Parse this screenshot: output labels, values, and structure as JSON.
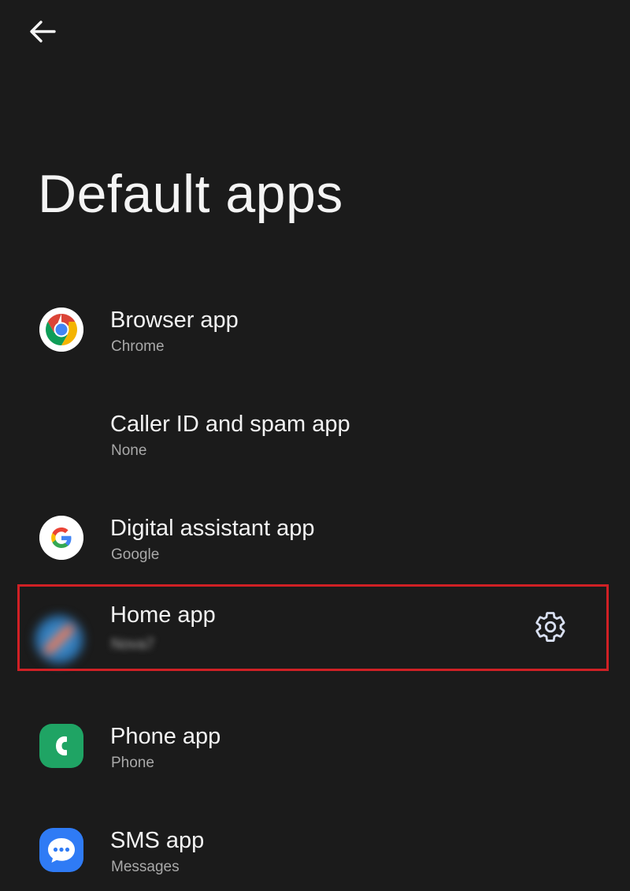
{
  "header": {
    "back_icon": "arrow-back-icon",
    "title": "Default apps"
  },
  "apps": [
    {
      "title": "Browser app",
      "value": "Chrome",
      "icon": "chrome-icon"
    },
    {
      "title": "Caller ID and spam app",
      "value": "None",
      "icon": ""
    },
    {
      "title": "Digital assistant app",
      "value": "Google",
      "icon": "google-icon"
    },
    {
      "title": "Home app",
      "value": "Nova7",
      "icon": "launcher-icon-blurred",
      "action_icon": "gear-icon"
    },
    {
      "title": "Phone app",
      "value": "Phone",
      "icon": "phone-icon"
    },
    {
      "title": "SMS app",
      "value": "Messages",
      "icon": "messages-icon"
    }
  ],
  "colors": {
    "background": "#1b1b1b",
    "highlight_border": "#d02025",
    "phone_green": "#1fa464",
    "messages_blue": "#2f7bf5"
  }
}
